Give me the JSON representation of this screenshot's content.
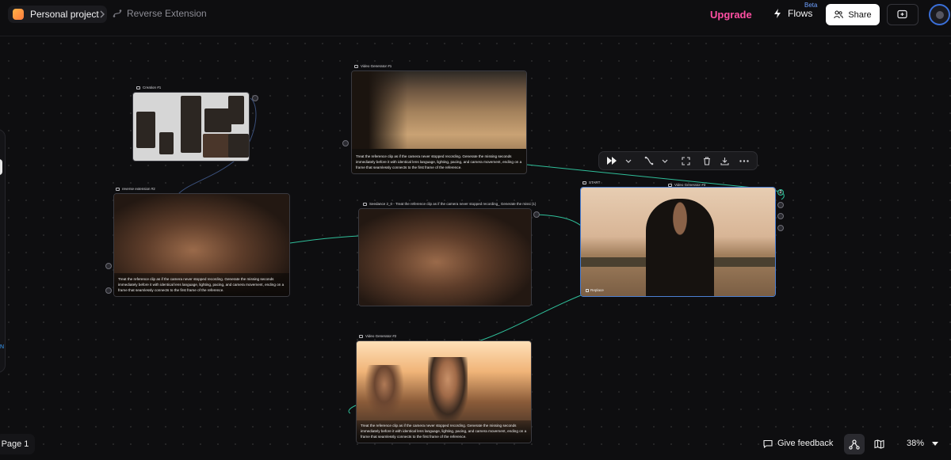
{
  "header": {
    "project_label": "Personal project",
    "flow_name": "Reverse Extension",
    "upgrade_label": "Upgrade",
    "flows_label": "Flows",
    "flows_badge": "Beta",
    "share_label": "Share",
    "accent_color": "#ff4fa3"
  },
  "canvas": {
    "nodes": [
      {
        "title": "Creation #1"
      },
      {
        "title": "Video Generator #1",
        "prompt": "Treat the reference clip as if the camera never stopped recording. Generate the missing seconds immediately before it with identical lens language, lighting, pacing, and camera movement, ending on a frame that seamlessly connects to the first frame of the reference."
      },
      {
        "title": "reverse extension #2",
        "prompt": "Treat the reference clip as if the camera never stopped recording. Generate the missing seconds immediately before it with identical lens language, lighting, pacing, and camera movement, ending on a frame that seamlessly connects to the first frame of the reference."
      },
      {
        "title": "Seedance 2_0 - Treat the reference clip as if the camera never stopped recording_ Generate the missi (1)"
      },
      {
        "title": "Video Generator #3",
        "start_label": "START",
        "replace_label": "Replace"
      },
      {
        "title": "Video Generator #2",
        "prompt": "Treat the reference clip as if the camera never stopped recording. Generate the missing seconds immediately before it with identical lens language, lighting, pacing, and camera movement, ending on a frame that seamlessly connects to the first frame of the reference."
      }
    ],
    "port_badge": "2",
    "left_panel_letter": "N"
  },
  "toolbar_icons": [
    "play-icon",
    "chevron-down-icon",
    "route-icon",
    "chevron-down-icon",
    "expand-icon",
    "trash-icon",
    "download-icon",
    "more-icon"
  ],
  "footer": {
    "page_label": "Page 1",
    "feedback_label": "Give feedback",
    "zoom_label": "38%"
  }
}
